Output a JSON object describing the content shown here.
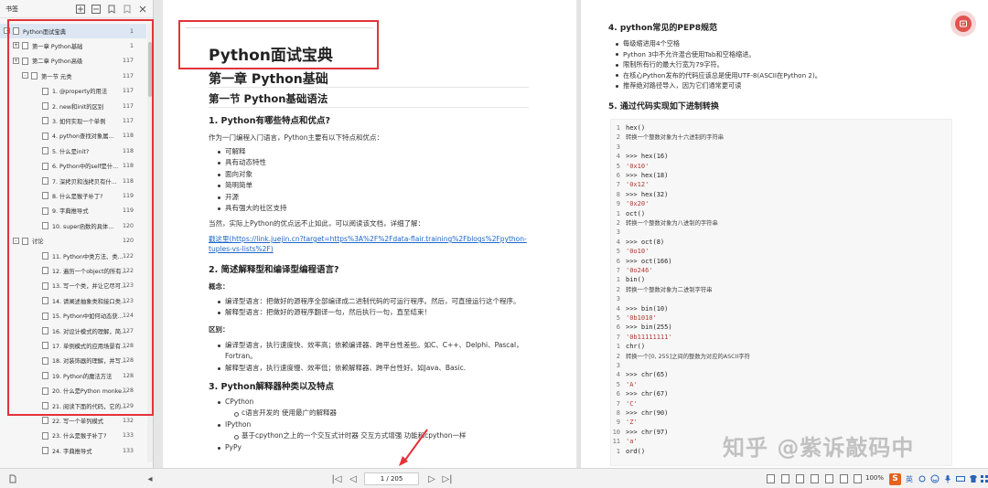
{
  "sidebar": {
    "title": "书签",
    "bookmarks": [
      {
        "label": "Python面试宝典",
        "page": "1",
        "level": 0,
        "expander": "-",
        "selected": true
      },
      {
        "label": "第一章 Python基础",
        "page": "1",
        "level": 1,
        "expander": "+"
      },
      {
        "label": "第二章 Python高级",
        "page": "117",
        "level": 1,
        "expander": "+"
      },
      {
        "label": "第一节 元类",
        "page": "117",
        "level": 2,
        "expander": "-"
      },
      {
        "label": "1. @property的用法",
        "page": "117",
        "level": 3
      },
      {
        "label": "2. new和init的区别",
        "page": "117",
        "level": 3
      },
      {
        "label": "3. 如何实现一个单例",
        "page": "117",
        "level": 3
      },
      {
        "label": "4. python查找对象属...",
        "page": "118",
        "level": 3
      },
      {
        "label": "5. 什么是init?",
        "page": "118",
        "level": 3
      },
      {
        "label": "6. Python中的self是什...",
        "page": "118",
        "level": 3
      },
      {
        "label": "7. 深拷贝和浅拷贝有什...",
        "page": "118",
        "level": 3
      },
      {
        "label": "8. 什么是猴子补丁?",
        "page": "119",
        "level": 3
      },
      {
        "label": "9. 字典推导式",
        "page": "119",
        "level": 3
      },
      {
        "label": "10. super函数的具体...",
        "page": "120",
        "level": 3
      },
      {
        "label": "讨论",
        "page": "120",
        "level": 1,
        "expander": "-"
      },
      {
        "label": "11. Python中类方法、类...",
        "page": "122",
        "level": 3
      },
      {
        "label": "12. 遍历一个object的所有...",
        "page": "122",
        "level": 3
      },
      {
        "label": "13. 写一个类，并让它尽可...",
        "page": "123",
        "level": 3
      },
      {
        "label": "14. 请阐述抽象类和接口类...",
        "page": "123",
        "level": 3
      },
      {
        "label": "15. Python中如何动态获...",
        "page": "124",
        "level": 3
      },
      {
        "label": "16. 对设计模式的理解，简...",
        "page": "127",
        "level": 3
      },
      {
        "label": "17. 单例模式的应用场景有...",
        "page": "128",
        "level": 3
      },
      {
        "label": "18. 对装饰器的理解，并写...",
        "page": "128",
        "level": 3
      },
      {
        "label": "19. Python的魔法方法",
        "page": "128",
        "level": 3
      },
      {
        "label": "20. 什么是Python monke...",
        "page": "128",
        "level": 3
      },
      {
        "label": "21. 阅读下面的代码，它的...",
        "page": "129",
        "level": 3
      },
      {
        "label": "22. 写一个单列模式",
        "page": "132",
        "level": 3
      },
      {
        "label": "23. 什么是猴子补丁?",
        "page": "133",
        "level": 3
      },
      {
        "label": "24. 字典推导式",
        "page": "133",
        "level": 3
      }
    ]
  },
  "left_page": {
    "doc_title": "Python面试宝典",
    "chapter": "第一章 Python基础",
    "section": "第一节 Python基础语法",
    "q1": "1. Python有哪些特点和优点?",
    "q1_intro": "作为一门编程入门语言，Python主要有以下特点和优点：",
    "q1_items": [
      "可解释",
      "具有动态特性",
      "面向对象",
      "简明简单",
      "开源",
      "具有强大的社区支持"
    ],
    "q1_more": "当然，实际上Python的优点远不止如此，可以阅读该文档，详细了解：",
    "q1_link": "戳这里(https://link.juejin.cn?target=https%3A%2F%2Fdata-flair.training%2Fblogs%2Fpython-tuples-vs-lists%2F)",
    "q2": "2. 简述解释型和编译型编程语言?",
    "q2_concept": "概念：",
    "q2_concept_items": [
      "编译型语言：把做好的源程序全部编译成二进制代码的可运行程序。然后，可直接运行这个程序。",
      "解释型语言：把做好的源程序翻译一句，然后执行一句，直至结束！"
    ],
    "q2_diff": "区别：",
    "q2_diff_items": [
      "编译型语言，执行速度快、效率高；依赖编译器、跨平台性差些。如C、C++、Delphi、Pascal，",
      "Fortran。",
      "解释型语言，执行速度慢、效率低；依赖解释器、跨平台性好。如Java、Basic."
    ],
    "q3": "3. Python解释器种类以及特点",
    "q3_items": [
      {
        "text": "CPython",
        "sub": [
          "c语言开发的 使用最广的解释器"
        ]
      },
      {
        "text": "IPython",
        "sub": [
          "基于cpython之上的一个交互式计时器 交互方式增强 功能和cpython一样"
        ]
      },
      {
        "text": "PyPy",
        "sub": []
      }
    ]
  },
  "right_page": {
    "q4": "4. python常见的PEP8规范",
    "q4_items": [
      "每级缩进用4个空格",
      "Python 3中不允许混合使用Tab和空格缩进。",
      "限制所有行的最大行宽为79字符。",
      "在核心Python发布的代码应该总是使用UTF-8(ASCII在Python 2)。",
      "推荐绝对路径导入，因为它们通常更可读"
    ],
    "q5": "5. 通过代码实现如下进制转换",
    "code_lines": [
      {
        "n": "1",
        "t": "hex()",
        "k": "code"
      },
      {
        "n": "2",
        "t": "转换一个整数对象为十六进制的字符串",
        "k": "cmt"
      },
      {
        "n": "3",
        "t": "",
        "k": "code"
      },
      {
        "n": "4",
        "t": ">>> hex(16)",
        "k": "code"
      },
      {
        "n": "5",
        "t": "'0x10'",
        "k": "str"
      },
      {
        "n": "6",
        "t": ">>> hex(18)",
        "k": "code"
      },
      {
        "n": "7",
        "t": "'0x12'",
        "k": "str"
      },
      {
        "n": "8",
        "t": ">>> hex(32)",
        "k": "code"
      },
      {
        "n": "9",
        "t": "'0x20'",
        "k": "str"
      },
      {
        "n": "1",
        "t": "oct()",
        "k": "code"
      },
      {
        "n": "2",
        "t": "转换一个整数对象为八进制的字符串",
        "k": "cmt"
      },
      {
        "n": "3",
        "t": "",
        "k": "code"
      },
      {
        "n": "4",
        "t": ">>> oct(8)",
        "k": "code"
      },
      {
        "n": "5",
        "t": "'0o10'",
        "k": "str"
      },
      {
        "n": "6",
        "t": ">>> oct(166)",
        "k": "code"
      },
      {
        "n": "7",
        "t": "'0o246'",
        "k": "str"
      },
      {
        "n": "1",
        "t": "bin()",
        "k": "code"
      },
      {
        "n": "2",
        "t": "转换一个整数对象为二进制字符串",
        "k": "cmt"
      },
      {
        "n": "3",
        "t": "",
        "k": "code"
      },
      {
        "n": "4",
        "t": ">>> bin(10)",
        "k": "code"
      },
      {
        "n": "5",
        "t": "'0b1010'",
        "k": "str"
      },
      {
        "n": "6",
        "t": ">>> bin(255)",
        "k": "code"
      },
      {
        "n": "7",
        "t": "'0b11111111'",
        "k": "str"
      },
      {
        "n": "1",
        "t": "chr()",
        "k": "code"
      },
      {
        "n": "2",
        "t": "转换一个[0, 255]之间的整数为对应的ASCII字符",
        "k": "cmt"
      },
      {
        "n": "3",
        "t": "",
        "k": "code"
      },
      {
        "n": "4",
        "t": ">>> chr(65)",
        "k": "code"
      },
      {
        "n": "5",
        "t": "'A'",
        "k": "str"
      },
      {
        "n": "6",
        "t": ">>> chr(67)",
        "k": "code"
      },
      {
        "n": "7",
        "t": "'C'",
        "k": "str"
      },
      {
        "n": "8",
        "t": ">>> chr(90)",
        "k": "code"
      },
      {
        "n": "9",
        "t": "'Z'",
        "k": "str"
      },
      {
        "n": "10",
        "t": ">>> chr(97)",
        "k": "code"
      },
      {
        "n": "11",
        "t": "'a'",
        "k": "str"
      },
      {
        "n": "1",
        "t": "ord()",
        "k": "code"
      }
    ],
    "watermark": "知乎 @紫诉敲码中"
  },
  "bottom": {
    "page_indicator": "1 / 205",
    "zoom": "100%",
    "ime": "S"
  },
  "colors": {
    "highlight_red": "#e3333a",
    "link_blue": "#1b66c9"
  }
}
